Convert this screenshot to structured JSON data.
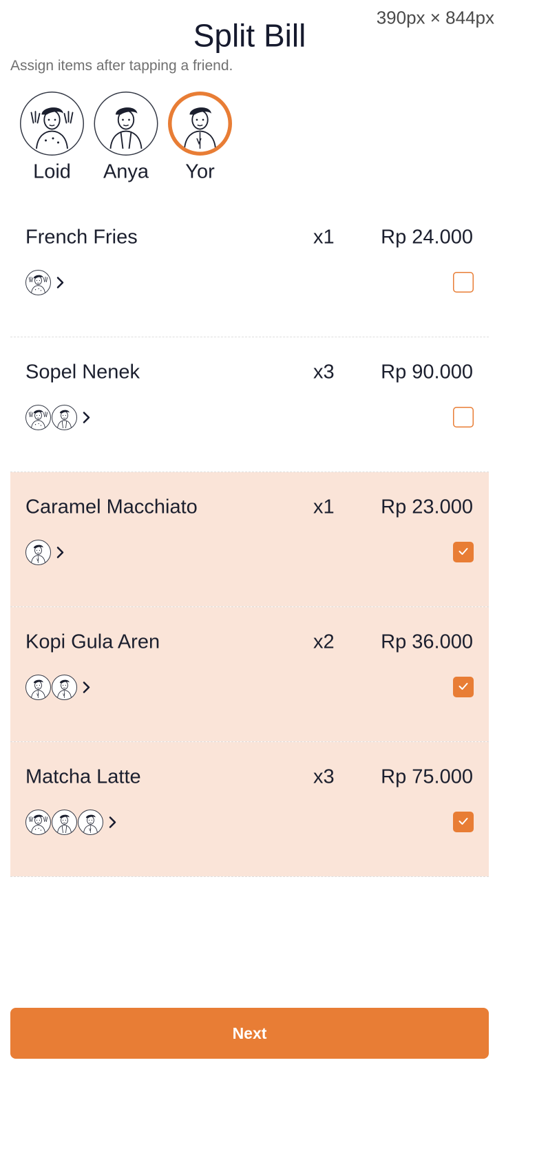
{
  "viewport_label": "390px × 844px",
  "header": {
    "title": "Split Bill",
    "subtitle": "Assign items after tapping a friend."
  },
  "friends": [
    {
      "name": "Loid",
      "avatar_icon": "person-waving-illustration-icon",
      "selected": false
    },
    {
      "name": "Anya",
      "avatar_icon": "person-casual-illustration-icon",
      "selected": false
    },
    {
      "name": "Yor",
      "avatar_icon": "person-shirt-illustration-icon",
      "selected": true
    }
  ],
  "items": [
    {
      "name": "French Fries",
      "qty": "x1",
      "price": "Rp 24.000",
      "checked": false,
      "assignees": [
        "Loid"
      ]
    },
    {
      "name": "Sopel Nenek",
      "qty": "x3",
      "price": "Rp 90.000",
      "checked": false,
      "assignees": [
        "Loid",
        "Anya"
      ]
    },
    {
      "name": "Caramel Macchiato",
      "qty": "x1",
      "price": "Rp 23.000",
      "checked": true,
      "assignees": [
        "Yor"
      ]
    },
    {
      "name": "Kopi Gula Aren",
      "qty": "x2",
      "price": "Rp 36.000",
      "checked": true,
      "assignees": [
        "Yor",
        "Yor"
      ]
    },
    {
      "name": "Matcha Latte",
      "qty": "x3",
      "price": "Rp 75.000",
      "checked": true,
      "assignees": [
        "Loid",
        "Anya",
        "Yor"
      ]
    }
  ],
  "footer": {
    "next_label": "Next"
  },
  "colors": {
    "accent": "#E87D35",
    "selected_row_bg": "#FAE4D8",
    "text": "#1b1f2e",
    "muted": "#707070"
  }
}
